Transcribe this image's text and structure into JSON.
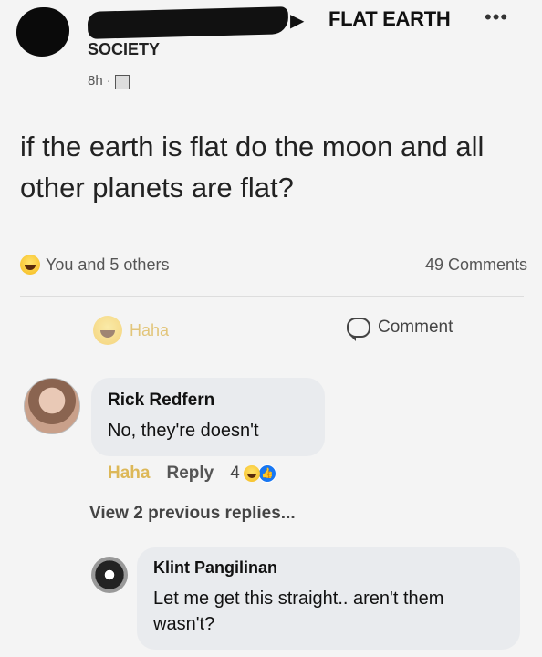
{
  "post": {
    "group_name_line1": "FLAT EARTH",
    "group_name_line2": "SOCIETY",
    "time": "8h",
    "text": "if the earth is flat do the moon and all other planets are flat?",
    "reactions_summary": "You and 5 others",
    "comments_count": "49 Comments",
    "actions": {
      "haha": "Haha",
      "comment": "Comment"
    }
  },
  "comments": [
    {
      "author": "Rick Redfern",
      "text": "No, they're doesn't",
      "actions": {
        "haha": "Haha",
        "reply": "Reply",
        "reaction_count": "4"
      }
    }
  ],
  "view_previous_replies": "View 2 previous replies...",
  "reply": {
    "author": "Klint Pangilinan",
    "text": "Let me get this straight.. aren't them wasn't?"
  },
  "icons": {
    "arrow": "right-triangle-icon",
    "more": "more-dots-icon",
    "audience": "globe-icon",
    "haha": "haha-emoji-icon",
    "comment": "comment-bubble-icon",
    "like": "like-badge-icon"
  },
  "colors": {
    "haha": "#d4a017",
    "like": "#1877f2",
    "bubble": "#e9ebee"
  }
}
